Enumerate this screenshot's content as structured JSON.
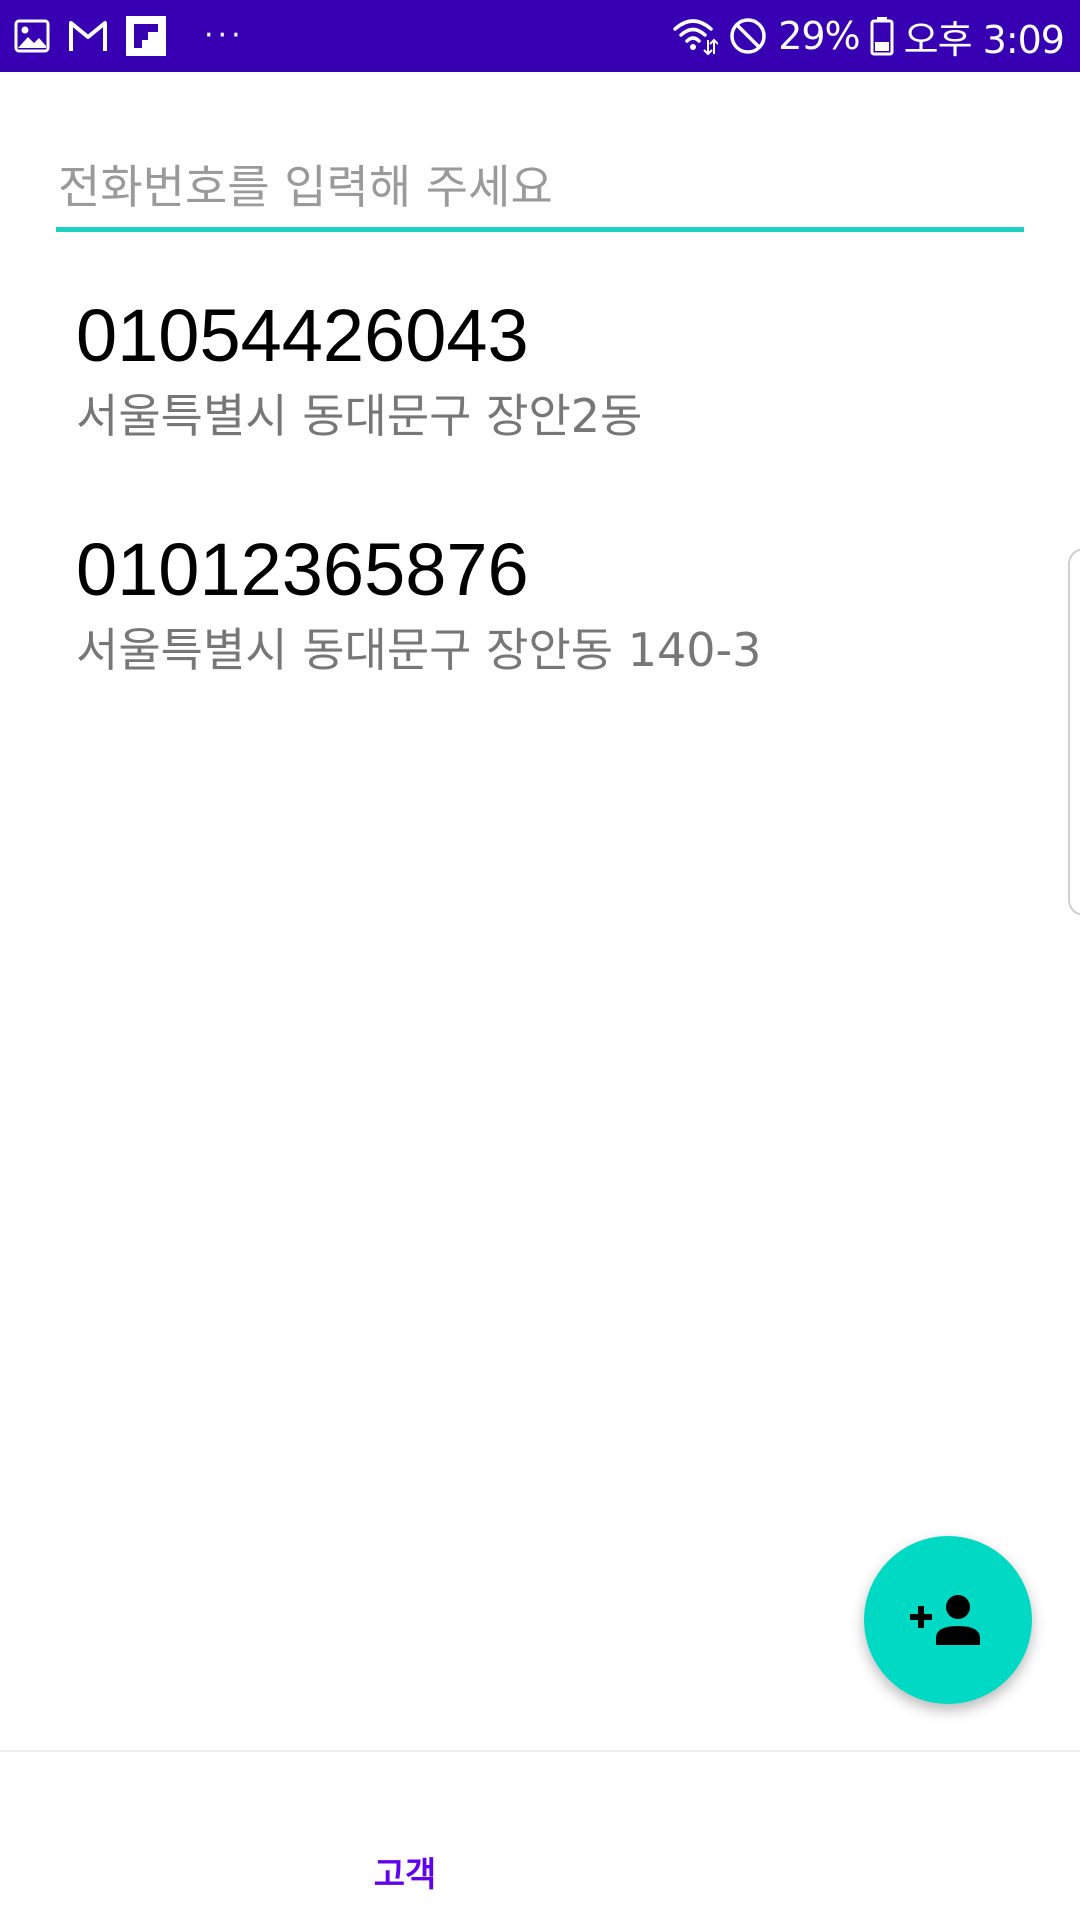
{
  "status_bar": {
    "battery_percent": "29%",
    "time": "오후 3:09",
    "more_indicator": "···",
    "icons": {
      "notifications": [
        "image-icon",
        "gmail-icon",
        "flipboard-icon"
      ],
      "system": [
        "wifi-icon",
        "do-not-disturb-icon",
        "battery-icon"
      ]
    },
    "background_color": "#3700b3"
  },
  "search": {
    "placeholder": "전화번호를 입력해 주세요",
    "value": "",
    "underline_color": "#1fd1c2"
  },
  "customers": [
    {
      "phone": "01054426043",
      "address": "서울특별시 동대문구 장안2동"
    },
    {
      "phone": "01012365876",
      "address": "서울특별시 동대문구 장안동 140-3"
    }
  ],
  "fab": {
    "icon": "person-add-icon",
    "color": "#00d9c3"
  },
  "bottom_nav": {
    "tabs": [
      {
        "label": "고객",
        "active": true
      }
    ],
    "active_color": "#6200ee"
  }
}
